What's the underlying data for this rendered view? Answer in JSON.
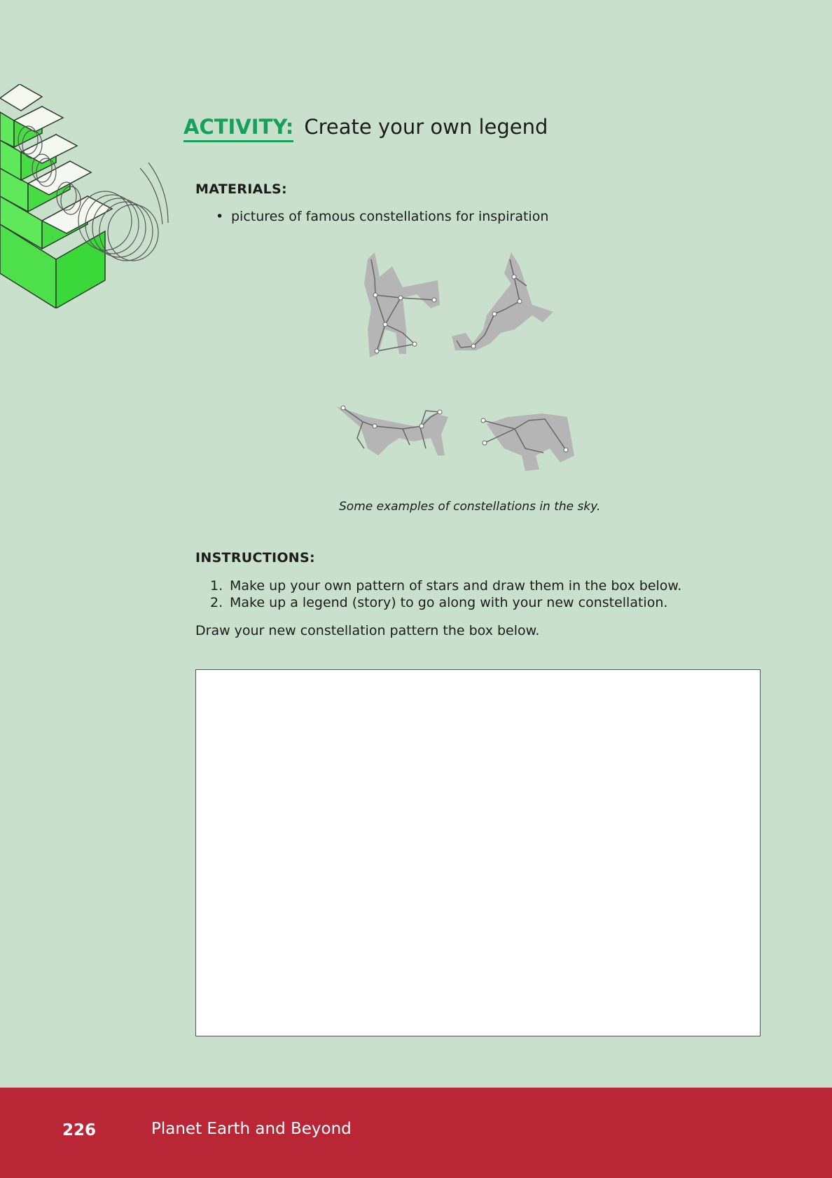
{
  "activity": {
    "label": "ACTIVITY:",
    "title": "Create your own legend"
  },
  "materials": {
    "heading": "MATERIALS:",
    "items": [
      "pictures of famous constellations for inspiration"
    ]
  },
  "figure": {
    "caption": "Some examples of constellations in the sky.",
    "images": [
      "hunter-constellation",
      "scorpion-constellation",
      "dog-constellation",
      "centaur-constellation"
    ]
  },
  "instructions": {
    "heading": "INSTRUCTIONS:",
    "steps": [
      {
        "num": "1.",
        "text": "Make up your own pattern of stars and draw them in the box below."
      },
      {
        "num": "2.",
        "text": "Make up a legend (story) to go along with your new constellation."
      }
    ],
    "draw_note": "Draw your new constellation pattern the box below."
  },
  "footer": {
    "page_number": "226",
    "book_title": "Planet Earth and Beyond"
  },
  "colors": {
    "background": "#c8e0cc",
    "accent_green": "#17a05a",
    "footer_red": "#b92736"
  }
}
